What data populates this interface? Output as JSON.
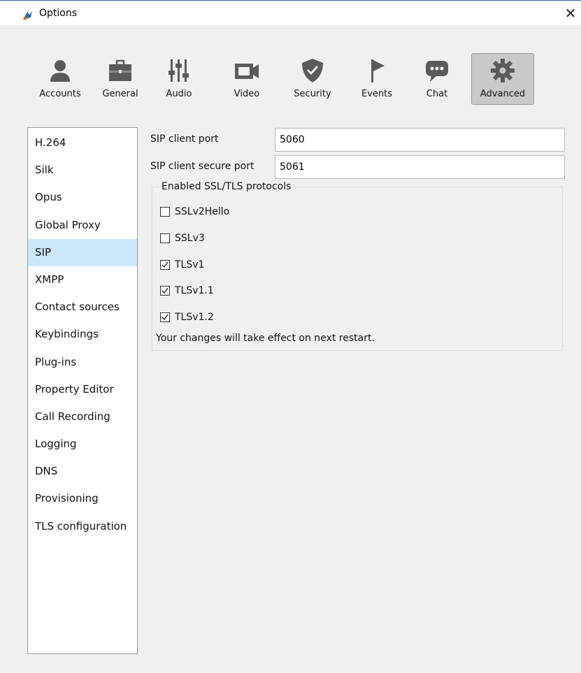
{
  "window": {
    "title": "Options",
    "close_glyph": "✕"
  },
  "toolbar": {
    "items": [
      {
        "label": "Accounts",
        "icon": "person-icon"
      },
      {
        "label": "General",
        "icon": "briefcase-icon"
      },
      {
        "label": "Audio",
        "icon": "equalizer-icon"
      },
      {
        "label": "Video",
        "icon": "camera-icon"
      },
      {
        "label": "Security",
        "icon": "shield-icon"
      },
      {
        "label": "Events",
        "icon": "flag-icon"
      },
      {
        "label": "Chat",
        "icon": "chat-bubble-icon"
      },
      {
        "label": "Advanced",
        "icon": "gear-icon"
      }
    ],
    "selected": "Advanced"
  },
  "sidebar": {
    "items": [
      {
        "label": "H.264"
      },
      {
        "label": "Silk"
      },
      {
        "label": "Opus"
      },
      {
        "label": "Global Proxy"
      },
      {
        "label": "SIP"
      },
      {
        "label": "XMPP"
      },
      {
        "label": "Contact sources"
      },
      {
        "label": "Keybindings"
      },
      {
        "label": "Plug-ins"
      },
      {
        "label": "Property Editor"
      },
      {
        "label": "Call Recording"
      },
      {
        "label": "Logging"
      },
      {
        "label": "DNS"
      },
      {
        "label": "Provisioning"
      },
      {
        "label": "TLS configuration"
      }
    ],
    "selected": "SIP"
  },
  "sip": {
    "client_port_label": "SIP client port",
    "client_port_value": "5060",
    "secure_port_label": "SIP client secure port",
    "secure_port_value": "5061",
    "protocols_title": "Enabled SSL/TLS protocols",
    "protocols": [
      {
        "label": "SSLv2Hello",
        "checked": false
      },
      {
        "label": "SSLv3",
        "checked": false
      },
      {
        "label": "TLSv1",
        "checked": true
      },
      {
        "label": "TLSv1.1",
        "checked": true
      },
      {
        "label": "TLSv1.2",
        "checked": true
      }
    ],
    "restart_note": "Your changes will take effect on next restart."
  },
  "colors": {
    "accent_border": "#2b6cb0",
    "selection": "#cce8f8",
    "icon_gray": "#5a5a5a"
  }
}
